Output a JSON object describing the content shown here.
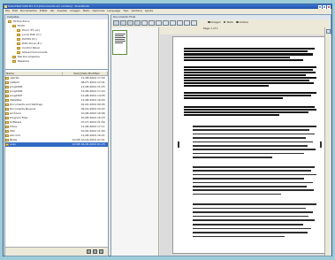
{
  "window": {
    "title": "Scan2Text OCR Pro 4.2 [Documento sin nombre] - ScanWorks"
  },
  "menubar": [
    "File",
    "Edit",
    "Documentos",
    "Editar",
    "Ver",
    "Insertar",
    "Imagen",
    "Texto",
    "Opciones",
    "Language",
    "Tipo",
    "Ventana",
    "Ayuda"
  ],
  "left_pane": {
    "tree_header": "Carpetas",
    "tree": [
      {
        "label": "Mi Escritorio",
        "indent": 0
      },
      {
        "label": "Mi PC",
        "indent": 1
      },
      {
        "label": "Disco 3½ (A:)",
        "indent": 2
      },
      {
        "label": "Local Disk (C:)",
        "indent": 2
      },
      {
        "label": "DATOS (D:)",
        "indent": 2
      },
      {
        "label": "DVD Drive (E:)",
        "indent": 2
      },
      {
        "label": "Control Panel",
        "indent": 2
      },
      {
        "label": "Shared Documents",
        "indent": 2
      },
      {
        "label": "Mis Documentos",
        "indent": 1
      },
      {
        "label": "Papelera",
        "indent": 1
      }
    ],
    "list_columns": {
      "name": "Name",
      "size": "Size",
      "modified": "Date Modified"
    },
    "files": [
      {
        "name": "cabrills",
        "size": "",
        "modified": "11-08-2004 17:40"
      },
      {
        "name": "vatter2",
        "size": "",
        "modified": "08-07-2004 12:01"
      },
      {
        "name": "prog2005",
        "size": "",
        "modified": "11-08-2004 11:25"
      },
      {
        "name": "prog2006",
        "size": "",
        "modified": "11-08-2004 17:24"
      },
      {
        "name": "prog2007",
        "size": "",
        "modified": "11-08-2004 14:05"
      },
      {
        "name": "diskettes",
        "size": "",
        "modified": "11-08-2004 16:00"
      },
      {
        "name": "Documents and Settings",
        "size": "",
        "modified": "01-02-2004 09:45"
      },
      {
        "name": "Documents Nuevos",
        "size": "",
        "modified": "09-04-2004 10:22"
      },
      {
        "name": "Archivos",
        "size": "",
        "modified": "10-08-2004 16:06"
      },
      {
        "name": "Program Files",
        "size": "",
        "modified": "10-08-2004 16:23"
      },
      {
        "name": "Software",
        "size": "",
        "modified": "07-07-2004 21:50"
      },
      {
        "name": "Fotos",
        "size": "",
        "modified": "11-08-2004 17:11"
      },
      {
        "name": "Utm",
        "size": "",
        "modified": "10-05-2004 11:04"
      },
      {
        "name": "wincmd",
        "size": "",
        "modified": "11-08-2004 16:21"
      },
      {
        "name": "BLOG",
        "size": "10 KB",
        "modified": "10-04-2004 07:41"
      },
      {
        "name": "scan",
        "size": "10 KB",
        "modified": "04-06-2004 21:23",
        "selected": true
      }
    ]
  },
  "right_pane": {
    "title": "Documento Final",
    "options": [
      "Imagen",
      "Texto",
      "Ambos"
    ],
    "page_label": "Page 1 of 1"
  },
  "colors": {
    "background": "#9ccdd8",
    "titlebar": "#1f4fa8",
    "selection": "#316ac5"
  }
}
